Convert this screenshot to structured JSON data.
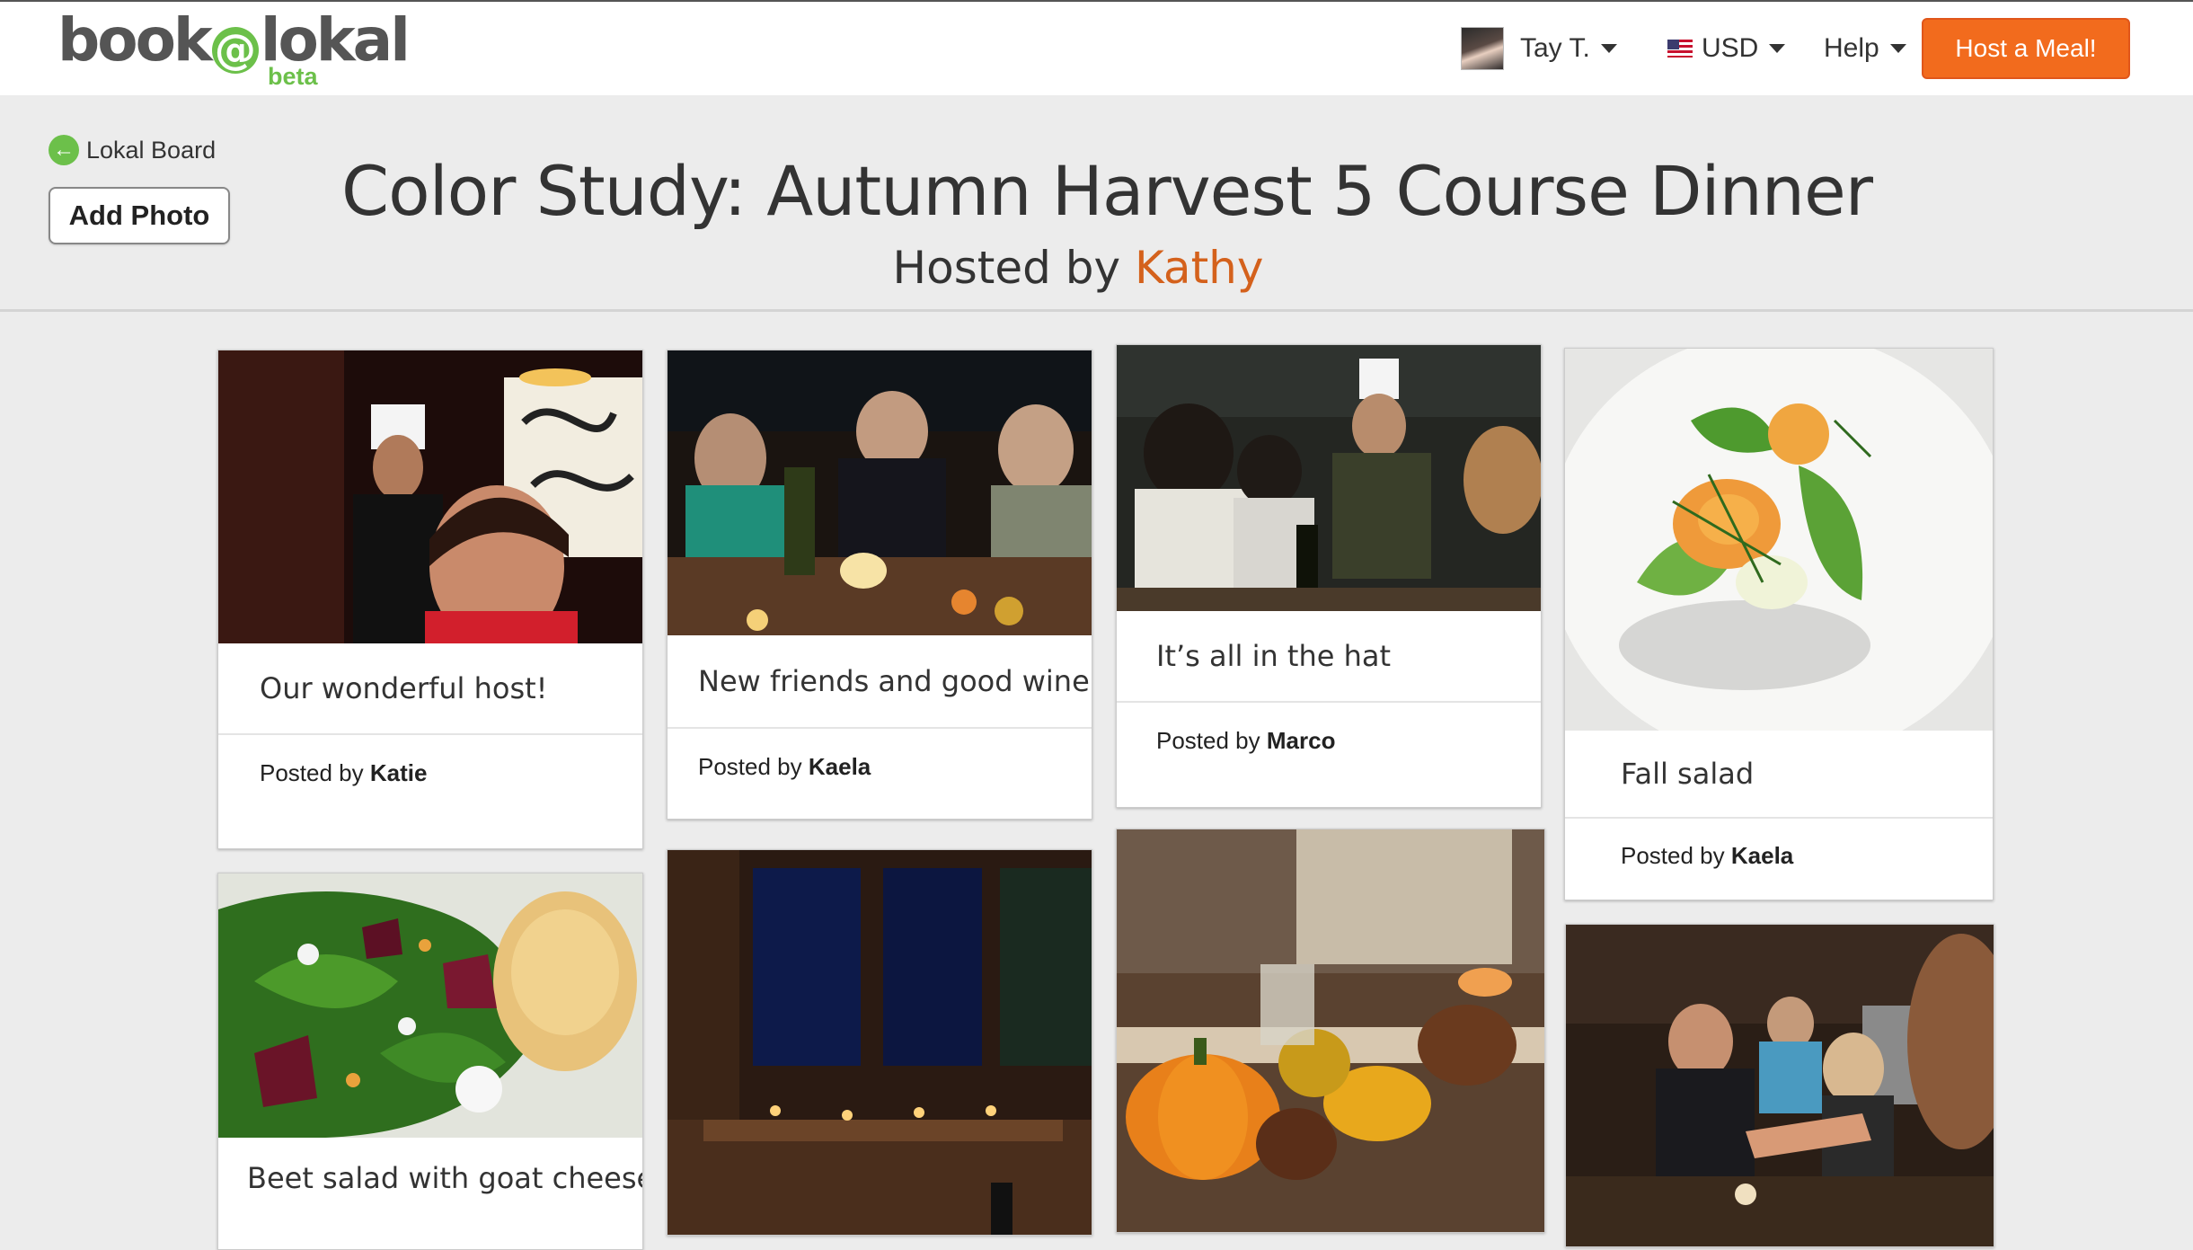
{
  "header": {
    "logo_main": "book",
    "logo_at": "@",
    "logo_tail": "lokal",
    "logo_badge": "beta",
    "user_name": "Tay T.",
    "currency": "USD",
    "help": "Help",
    "host_button": "Host a Meal!"
  },
  "colors": {
    "brand_green": "#6cc04a",
    "brand_orange": "#f26b1d",
    "host_name_orange": "#d4611c"
  },
  "back_link": "Lokal Board",
  "add_photo": "Add Photo",
  "event": {
    "title": "Color Study: Autumn Harvest 5 Course Dinner",
    "hosted_prefix": "Hosted by",
    "host_name": "Kathy"
  },
  "posts": [
    {
      "caption": "Our wonderful host!",
      "posted_prefix": "Posted by",
      "author": "Katie"
    },
    {
      "caption": "New friends and good wine",
      "posted_prefix": "Posted by",
      "author": "Kaela"
    },
    {
      "caption": "It’s all in the hat",
      "posted_prefix": "Posted by",
      "author": "Marco"
    },
    {
      "caption": "Fall salad",
      "posted_prefix": "Posted by",
      "author": "Kaela"
    },
    {
      "caption": "Beet salad with goat cheese"
    },
    {
      "caption": ""
    },
    {
      "caption": ""
    },
    {
      "caption": ""
    }
  ]
}
